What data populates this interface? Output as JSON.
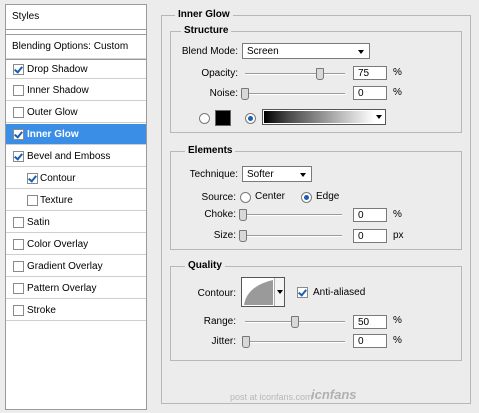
{
  "sidebar": {
    "styles_label": "Styles",
    "blending_label": "Blending Options: Custom",
    "items": [
      {
        "label": "Drop Shadow",
        "checked": true
      },
      {
        "label": "Inner Shadow",
        "checked": false
      },
      {
        "label": "Outer Glow",
        "checked": false
      },
      {
        "label": "Inner Glow",
        "checked": true,
        "selected": true
      },
      {
        "label": "Bevel and Emboss",
        "checked": true
      },
      {
        "label": "Contour",
        "checked": true,
        "sub": true
      },
      {
        "label": "Texture",
        "checked": false,
        "sub": true
      },
      {
        "label": "Satin",
        "checked": false
      },
      {
        "label": "Color Overlay",
        "checked": false
      },
      {
        "label": "Gradient Overlay",
        "checked": false
      },
      {
        "label": "Pattern Overlay",
        "checked": false
      },
      {
        "label": "Stroke",
        "checked": false
      }
    ]
  },
  "panel": {
    "title": "Inner Glow",
    "structure": {
      "title": "Structure",
      "blend_mode_label": "Blend Mode:",
      "blend_mode_value": "Screen",
      "opacity_label": "Opacity:",
      "opacity_value": "75",
      "opacity_fraction": 0.75,
      "opacity_unit": "%",
      "noise_label": "Noise:",
      "noise_value": "0",
      "noise_fraction": 0,
      "noise_unit": "%",
      "color_swatch": "#000000",
      "gradient_selected": true
    },
    "elements": {
      "title": "Elements",
      "technique_label": "Technique:",
      "technique_value": "Softer",
      "source_label": "Source:",
      "center_label": "Center",
      "edge_label": "Edge",
      "source_value": "Edge",
      "choke_label": "Choke:",
      "choke_value": "0",
      "choke_unit": "%",
      "size_label": "Size:",
      "size_value": "0",
      "size_unit": "px"
    },
    "quality": {
      "title": "Quality",
      "contour_label": "Contour:",
      "anti_aliased_label": "Anti-aliased",
      "anti_aliased": true,
      "range_label": "Range:",
      "range_value": "50",
      "range_fraction": 0.5,
      "range_unit": "%",
      "jitter_label": "Jitter:",
      "jitter_value": "0",
      "jitter_unit": "%"
    }
  },
  "watermark": {
    "text": "post at iconfans.com",
    "logo": "icnfans"
  },
  "colors": {
    "selection": "#3a8ee6",
    "check": "#1b5fb5"
  }
}
